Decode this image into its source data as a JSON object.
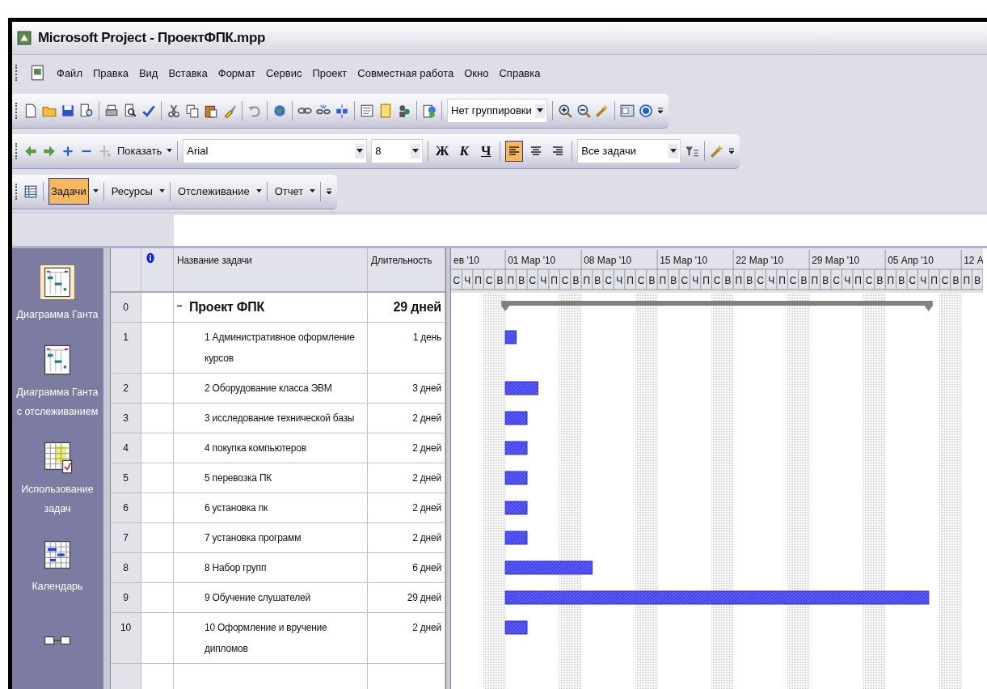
{
  "window": {
    "title": "Microsoft Project - ПроектФПК.mpp"
  },
  "menu": [
    "Файл",
    "Правка",
    "Вид",
    "Вставка",
    "Формат",
    "Сервис",
    "Проект",
    "Совместная работа",
    "Окно",
    "Справка"
  ],
  "toolbar_standard": {
    "grouping": "Нет группировки"
  },
  "toolbar_formatting": {
    "show": "Показать",
    "font": "Arial",
    "size": "8",
    "bold": "Ж",
    "italic": "К",
    "underline": "Ч",
    "filter": "Все задачи",
    "align": [
      {
        "selected": true
      },
      {
        "selected": false
      },
      {
        "selected": false
      }
    ]
  },
  "toolbar_guide": {
    "items": [
      {
        "label": "Задачи",
        "selected": true
      },
      {
        "label": "Ресурсы",
        "selected": false
      },
      {
        "label": "Отслеживание",
        "selected": false
      },
      {
        "label": "Отчет",
        "selected": false
      }
    ]
  },
  "view_bar": {
    "items": [
      {
        "label": "Диаграмма Ганта",
        "selected": true
      },
      {
        "label": "Диаграмма Ганта с отслеживанием",
        "selected": false
      },
      {
        "label": "Использование задач",
        "selected": false
      },
      {
        "label": "Календарь",
        "selected": false
      },
      {
        "selected": false
      }
    ]
  },
  "table": {
    "columns": {
      "name": "Название задачи",
      "duration": "Длительность"
    },
    "rows": [
      {
        "id": "0",
        "name": "Проект ФПК",
        "duration": "29 дней",
        "kind": "summary",
        "expanded": true
      },
      {
        "id": "1",
        "name": "1 Административное оформление курсов",
        "duration": "1 день",
        "kind": "task"
      },
      {
        "id": "2",
        "name": "2 Оборудование класса ЭВМ",
        "duration": "3 дней",
        "kind": "task"
      },
      {
        "id": "3",
        "name": "3 исследование технической базы",
        "duration": "2 дней",
        "kind": "task"
      },
      {
        "id": "4",
        "name": "4 покупка компьютеров",
        "duration": "2 дней",
        "kind": "task"
      },
      {
        "id": "5",
        "name": "5 перевозка ПК",
        "duration": "2 дней",
        "kind": "task"
      },
      {
        "id": "6",
        "name": "6 установка пк",
        "duration": "2 дней",
        "kind": "task"
      },
      {
        "id": "7",
        "name": "7 установка программ",
        "duration": "2 дней",
        "kind": "task"
      },
      {
        "id": "8",
        "name": "8 Набор групп",
        "duration": "6 дней",
        "kind": "task"
      },
      {
        "id": "9",
        "name": "9 Обучение слушателей",
        "duration": "29 дней",
        "kind": "task"
      },
      {
        "id": "10",
        "name": "10 Оформление и вручение дипломов",
        "duration": "2 дней",
        "kind": "task"
      }
    ]
  },
  "gantt": {
    "day_letters": [
      "С",
      "Ч",
      "П",
      "С",
      "В",
      "П",
      "В",
      "С",
      "Ч",
      "П",
      "С",
      "В",
      "П",
      "В",
      "С",
      "Ч",
      "П",
      "С",
      "В",
      "П",
      "В",
      "С",
      "Ч",
      "П",
      "С",
      "В",
      "П",
      "В",
      "С",
      "Ч",
      "П",
      "С",
      "В",
      "П",
      "В",
      "С",
      "Ч",
      "П",
      "С",
      "В",
      "П",
      "В",
      "С",
      "Ч",
      "П",
      "С",
      "В",
      "П",
      "В"
    ],
    "weeks": [
      "ев '10",
      "01 Мар '10",
      "08 Мар '10",
      "15 Мар '10",
      "22 Мар '10",
      "29 Мар '10",
      "05 Апр '10",
      "12 А"
    ]
  }
}
